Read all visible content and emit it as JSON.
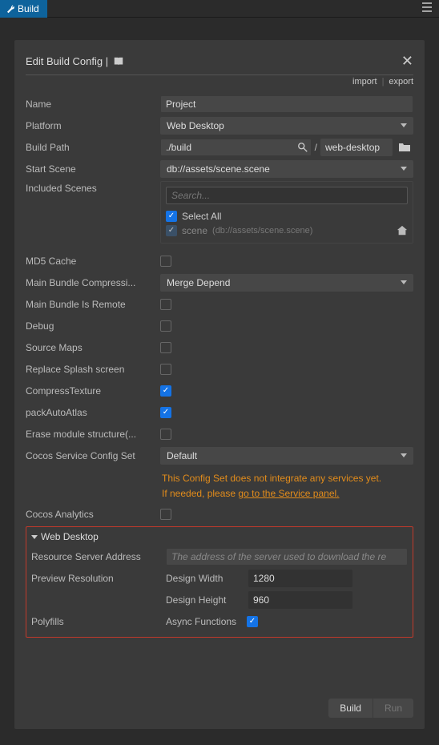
{
  "tab": {
    "label": "Build"
  },
  "panel": {
    "title": "Edit Build Config |",
    "import": "import",
    "export": "export"
  },
  "form": {
    "name_label": "Name",
    "name_value": "Project",
    "platform_label": "Platform",
    "platform_value": "Web Desktop",
    "buildpath_label": "Build Path",
    "buildpath_value": "./build",
    "buildpath_suffix": "web-desktop",
    "startscene_label": "Start Scene",
    "startscene_value": "db://assets/scene.scene",
    "inclscenes_label": "Included Scenes",
    "scenes_search_ph": "Search...",
    "select_all": "Select All",
    "scene_name": "scene",
    "scene_path": "(db://assets/scene.scene)",
    "md5_label": "MD5 Cache",
    "bundlecomp_label": "Main Bundle Compressi...",
    "bundlecomp_value": "Merge Depend",
    "bundleremote_label": "Main Bundle Is Remote",
    "debug_label": "Debug",
    "sourcemaps_label": "Source Maps",
    "splash_label": "Replace Splash screen",
    "comptex_label": "CompressTexture",
    "packatlas_label": "packAutoAtlas",
    "erase_label": "Erase module structure(...",
    "svcset_label": "Cocos Service Config Set",
    "svcset_value": "Default",
    "svc_msg1": "This Config Set does not integrate any services yet.",
    "svc_msg2a": "If needed, please ",
    "svc_msg2b": "go to the Service panel.",
    "analytics_label": "Cocos Analytics",
    "section_title": "Web Desktop",
    "ressrv_label": "Resource Server Address",
    "ressrv_ph": "The address of the server used to download the re",
    "previewres_label": "Preview Resolution",
    "dw_label": "Design Width",
    "dw_value": "1280",
    "dh_label": "Design Height",
    "dh_value": "960",
    "polyfills_label": "Polyfills",
    "async_label": "Async Functions"
  },
  "buttons": {
    "build": "Build",
    "run": "Run"
  }
}
